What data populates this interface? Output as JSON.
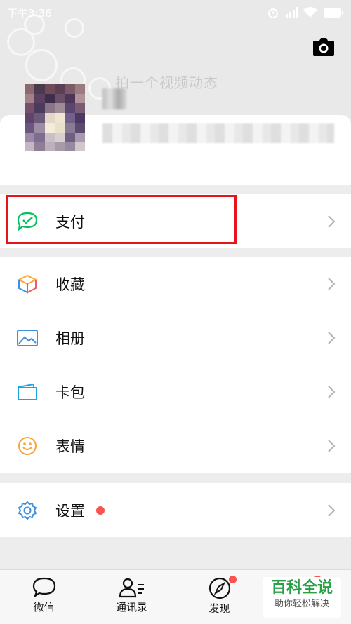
{
  "status_bar": {
    "time": "下午3:36"
  },
  "header": {
    "moment_hint": "拍一个视频动态"
  },
  "menu": {
    "pay": {
      "label": "支付"
    },
    "items": [
      {
        "label": "收藏",
        "icon": "favorites-cube-icon"
      },
      {
        "label": "相册",
        "icon": "album-picture-icon"
      },
      {
        "label": "卡包",
        "icon": "card-wallet-icon"
      },
      {
        "label": "表情",
        "icon": "sticker-smile-icon"
      }
    ],
    "settings": {
      "label": "设置"
    }
  },
  "tabbar": {
    "tabs": [
      {
        "label": "微信",
        "icon": "chat-bubble-icon"
      },
      {
        "label": "通讯录",
        "icon": "contacts-icon"
      },
      {
        "label": "发现",
        "icon": "compass-icon"
      }
    ]
  },
  "watermark": {
    "title": "百科全说",
    "subtitle": "助你轻松解决"
  },
  "colors": {
    "accent_green": "#07c160",
    "red_dot": "#fa5151",
    "highlight": "#e8141c"
  }
}
